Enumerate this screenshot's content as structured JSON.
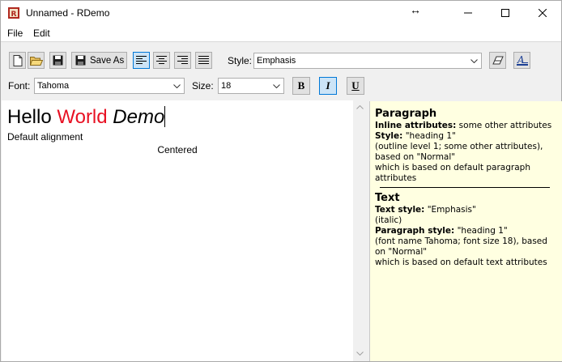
{
  "window": {
    "title": "Unnamed - RDemo"
  },
  "menu": {
    "file": "File",
    "edit": "Edit"
  },
  "toolbar": {
    "save_as_label": "Save As",
    "style_label": "Style:",
    "style_value": "Emphasis",
    "font_label": "Font:",
    "font_value": "Tahoma",
    "size_label": "Size:",
    "size_value": "18",
    "bold_label": "B",
    "italic_label": "I",
    "underline_label": "U"
  },
  "editor": {
    "line1": {
      "hello": "Hello",
      "world": "World",
      "demo": "Demo"
    },
    "line2": "Default alignment",
    "line3": "Centered",
    "colors": {
      "world": "#e81123"
    }
  },
  "info": {
    "paragraph": {
      "heading": "Paragraph",
      "inline_label": "Inline attributes:",
      "inline_value": "some other attributes",
      "style_label": "Style:",
      "style_value": "\"heading 1\"",
      "line3": "(outline level 1; some other attributes), based on \"Normal\"",
      "line4": "which is based on default paragraph attributes"
    },
    "text": {
      "heading": "Text",
      "text_style_label": "Text style:",
      "text_style_value": "\"Emphasis\"",
      "line2": "(italic)",
      "para_style_label": "Paragraph style:",
      "para_style_value": "\"heading 1\"",
      "line4": "(font name Tahoma; font size 18), based on \"Normal\"",
      "line5": "which is based on default text attributes"
    }
  },
  "icons": [
    "app-icon",
    "move-icon",
    "minimize-icon",
    "maximize-icon",
    "close-icon",
    "new-document-icon",
    "open-folder-icon",
    "save-icon",
    "align-left-icon",
    "align-center-icon",
    "align-right-icon",
    "justify-icon",
    "eraser-icon",
    "font-color-icon"
  ]
}
